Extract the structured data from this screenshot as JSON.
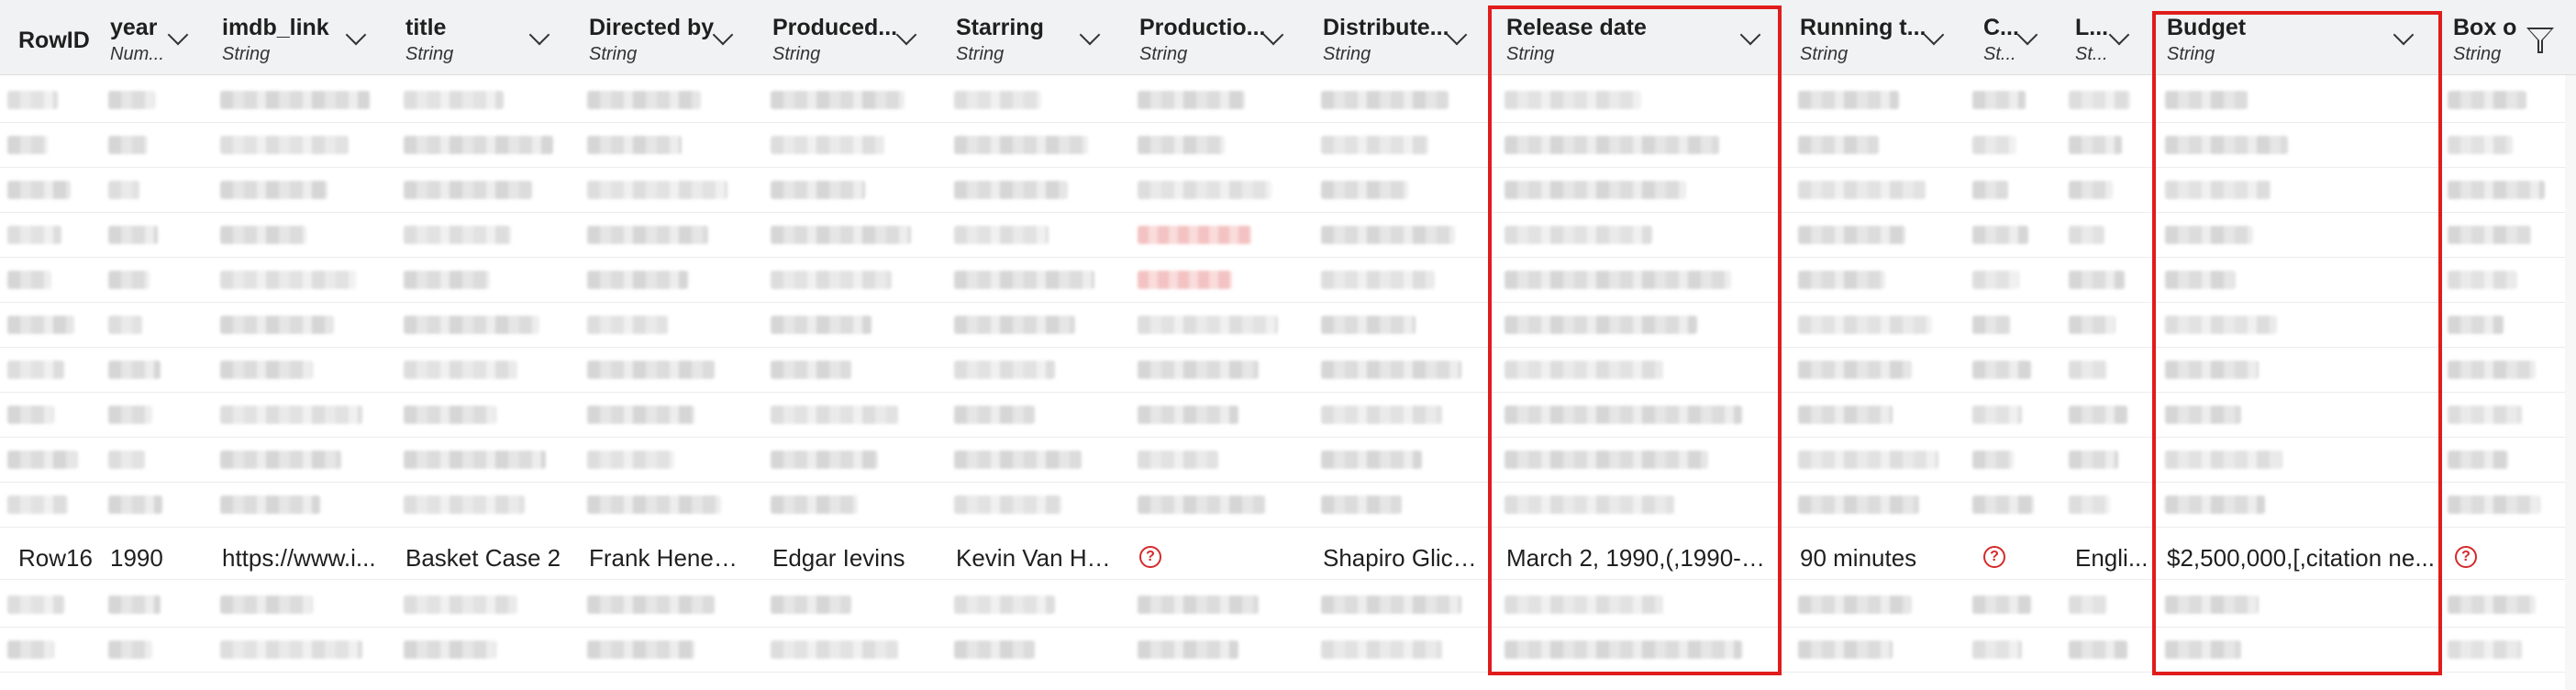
{
  "columns": [
    {
      "name": "RowID",
      "type": ""
    },
    {
      "name": "year",
      "type": "Num..."
    },
    {
      "name": "imdb_link",
      "type": "String"
    },
    {
      "name": "title",
      "type": "String"
    },
    {
      "name": "Directed by",
      "type": "String"
    },
    {
      "name": "Produced...",
      "type": "String"
    },
    {
      "name": "Starring",
      "type": "String"
    },
    {
      "name": "Productio...",
      "type": "String"
    },
    {
      "name": "Distribute...",
      "type": "String"
    },
    {
      "name": "Release date",
      "type": "String"
    },
    {
      "name": "Running t...",
      "type": "String"
    },
    {
      "name": "C...",
      "type": "St..."
    },
    {
      "name": "L...",
      "type": "St..."
    },
    {
      "name": "Budget",
      "type": "String"
    },
    {
      "name": "Box o",
      "type": "String"
    }
  ],
  "visible_row": {
    "RowID": "Row16",
    "year": "1990",
    "imdb_link": "https://www.i...",
    "title": "Basket Case 2",
    "directed_by": "Frank Henenl...",
    "produced_by": "Edgar Ievins",
    "starring": "Kevin Van He...",
    "production": "missing",
    "distributed_by": "Shapiro Glick...",
    "release_date": "March 2, 1990,(,1990-03...",
    "running_time": "90 minutes",
    "country": "missing",
    "language": "Engli...",
    "budget": "$2,500,000,[,citation ne...",
    "box_office": "missing"
  },
  "icons": {
    "missing": "question-circle-icon",
    "filter": "filter-icon",
    "sort": "chevron-down-icon"
  },
  "colors": {
    "highlight": "#e01c1c",
    "missing": "#d42a2a",
    "header_bg": "#f1f2f3"
  },
  "highlighted_columns": [
    "Release date",
    "Budget"
  ]
}
